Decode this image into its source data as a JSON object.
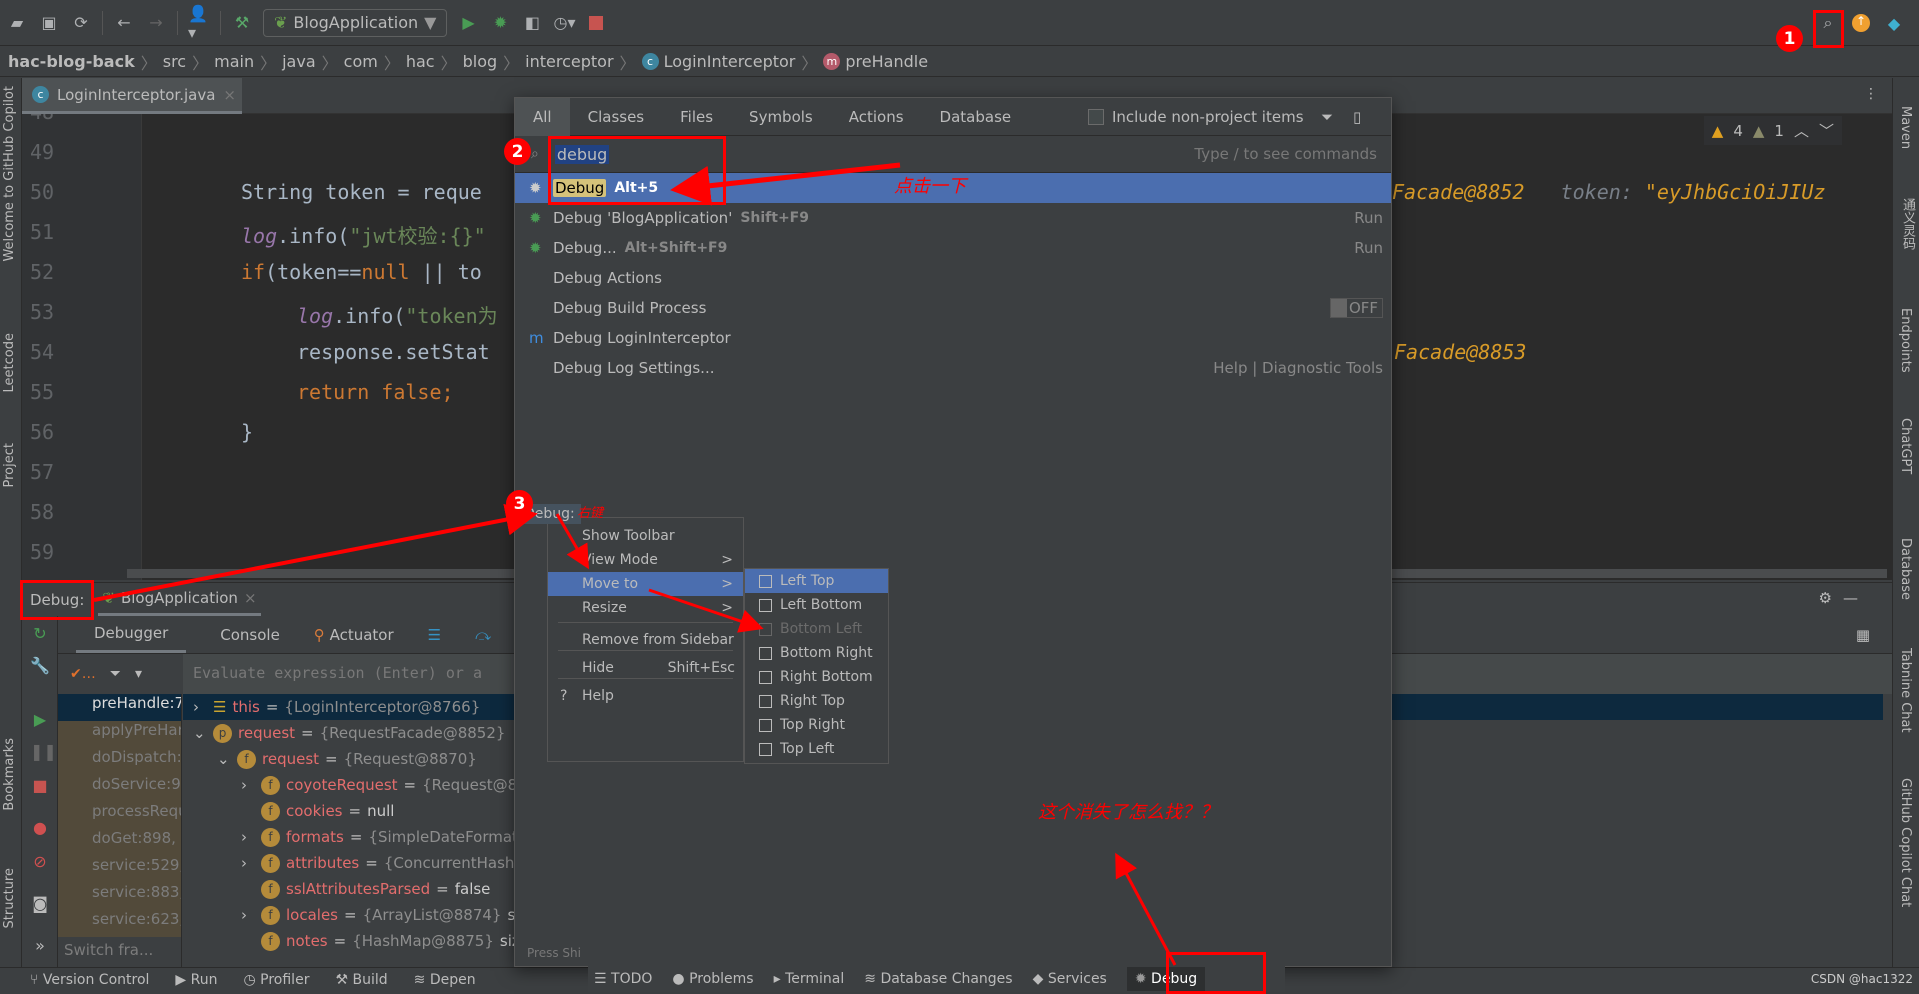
{
  "toolbar": {
    "run_config": "BlogApplication",
    "icons": [
      "open-icon",
      "save-icon",
      "sync-icon",
      "back-icon",
      "forward-icon",
      "user-icon",
      "build-hammer-icon",
      "run-icon",
      "debug-icon",
      "coverage-icon",
      "profile-icon",
      "stop-icon",
      "search-icon",
      "update-icon",
      "plugin-icon"
    ]
  },
  "breadcrumb": [
    "hac-blog-back",
    "src",
    "main",
    "java",
    "com",
    "hac",
    "blog",
    "interceptor",
    "LoginInterceptor",
    "preHandle"
  ],
  "left_strip": [
    "Welcome to GitHub Copilot",
    "Leetcode",
    "Project",
    "Bookmarks",
    "Structure"
  ],
  "right_strip": [
    "Maven",
    "通义灵码",
    "Endpoints",
    "ChatGPT",
    "Database",
    "Tabnine Chat",
    "GitHub Copilot Chat"
  ],
  "editor": {
    "tab": "LoginInterceptor.java",
    "warnings": {
      "warn": "4",
      "weak": "1"
    },
    "line_numbers": [
      "48",
      "49",
      "50",
      "51",
      "52",
      "53",
      "54",
      "55",
      "56",
      "57",
      "58",
      "59"
    ],
    "lines": {
      "l50": "String token = reque",
      "l51a": "log",
      "l51b": ".info(",
      "l51c": "\"jwt校验:{}\"",
      "l52a": "if",
      "l52b": "(token==",
      "l52c": "null",
      "l52d": " || to",
      "l53a": "log",
      "l53b": ".info(",
      "l53c": "\"token为",
      "l54": "response.setStat",
      "l55": "return false;",
      "l56": "}"
    },
    "inline_hints": {
      "l50_value": "Facade@8852",
      "l50_label": "token:",
      "l50_token": "\"eyJhbGciOiJIUz",
      "l54_value": "Facade@8853"
    }
  },
  "debug": {
    "label": "Debug:",
    "session": "BlogApplication",
    "tabs": [
      "Debugger",
      "Console",
      "Actuator"
    ],
    "eval_placeholder": "Evaluate expression (Enter) or a",
    "frames": [
      "preHandle:7",
      "applyPreHan",
      "doDispatch:1",
      "doService:96",
      "processRequ",
      "doGet:898, I",
      "service:529,",
      "service:883,",
      "service:623,"
    ],
    "switch_frames": "Switch fra...",
    "variables": [
      {
        "name": "this",
        "value": "{LoginInterceptor@8766}",
        "icon": "list",
        "expand": ">"
      },
      {
        "name": "request",
        "value": "{RequestFacade@8852}",
        "icon": "p",
        "expand": "v"
      },
      {
        "name": "request",
        "value": "{Request@8870}",
        "icon": "f",
        "expand": "v"
      },
      {
        "name": "coyoteRequest",
        "value": "{Request@88",
        "icon": "f",
        "expand": ">"
      },
      {
        "name": "cookies",
        "value": "null",
        "icon": "f",
        "expand": ""
      },
      {
        "name": "formats",
        "value": "{SimpleDateFormat[3",
        "icon": "f",
        "expand": ">"
      },
      {
        "name": "attributes",
        "value": "{ConcurrentHashM",
        "icon": "f",
        "expand": ">"
      },
      {
        "name": "sslAttributesParsed",
        "value": "false",
        "icon": "f",
        "expand": ""
      },
      {
        "name": "locales",
        "value": "{ArrayList@8874}",
        "extra": "size",
        "icon": "f",
        "expand": ">"
      },
      {
        "name": "notes",
        "value": "{HashMap@8875}",
        "extra": "size",
        "icon": "f",
        "expand": ""
      }
    ]
  },
  "search_popup": {
    "tabs": [
      "All",
      "Classes",
      "Files",
      "Symbols",
      "Actions",
      "Database"
    ],
    "include_non_project": "Include non-project items",
    "query": "debug",
    "hint": "Type / to see commands",
    "results": [
      {
        "label": "Debug",
        "shortcut": "Alt+5",
        "right": "",
        "icon": "debug-window-icon"
      },
      {
        "label": "Debug 'BlogApplication'",
        "shortcut": "Shift+F9",
        "right": "Run",
        "icon": "debug-icon"
      },
      {
        "label": "Debug...",
        "shortcut": "Alt+Shift+F9",
        "right": "Run",
        "icon": "debug-icon"
      },
      {
        "label": "Debug Actions",
        "shortcut": "",
        "right": "",
        "icon": ""
      },
      {
        "label": "Debug Build Process",
        "shortcut": "",
        "right": "OFF",
        "icon": ""
      },
      {
        "label": "Debug LoginInterceptor",
        "shortcut": "",
        "right": "",
        "icon": "maven-icon"
      },
      {
        "label": "Debug Log Settings...",
        "shortcut": "",
        "right": "Help | Diagnostic Tools",
        "icon": ""
      }
    ],
    "press_hint": "Press Shi"
  },
  "context_menu": {
    "items": [
      {
        "label": "Show Toolbar",
        "shortcut": ""
      },
      {
        "label": "View Mode",
        "shortcut": ">"
      },
      {
        "label": "Move to",
        "shortcut": ">"
      },
      {
        "label": "Resize",
        "shortcut": ">"
      },
      {
        "label": "Remove from Sidebar",
        "shortcut": ""
      },
      {
        "label": "Hide",
        "shortcut": "Shift+Esc"
      },
      {
        "label": "Help",
        "shortcut": ""
      }
    ],
    "submenu": [
      "Left Top",
      "Left Bottom",
      "Bottom Left",
      "Bottom Right",
      "Right Bottom",
      "Right Top",
      "Top Right",
      "Top Left"
    ],
    "submenu_disabled": "Bottom Left"
  },
  "statusbar": {
    "left": [
      "Version Control",
      "Run",
      "Profiler",
      "Build",
      "Depen"
    ],
    "toolwindows": [
      "TODO",
      "Problems",
      "Terminal",
      "Database Changes",
      "Services",
      "Debug"
    ],
    "watermark": "CSDN @hac1322"
  },
  "annotations": {
    "step1": "1",
    "step2": "2",
    "step3": "3",
    "click_once": "点击一下",
    "right_click": "右键",
    "question": "这个消失了怎么找？？"
  },
  "colors": {
    "accent": "#4b6eaf",
    "annotation": "#ff0000",
    "keyword": "#cc7832",
    "string": "#6a8759",
    "hint": "#d89b28"
  }
}
